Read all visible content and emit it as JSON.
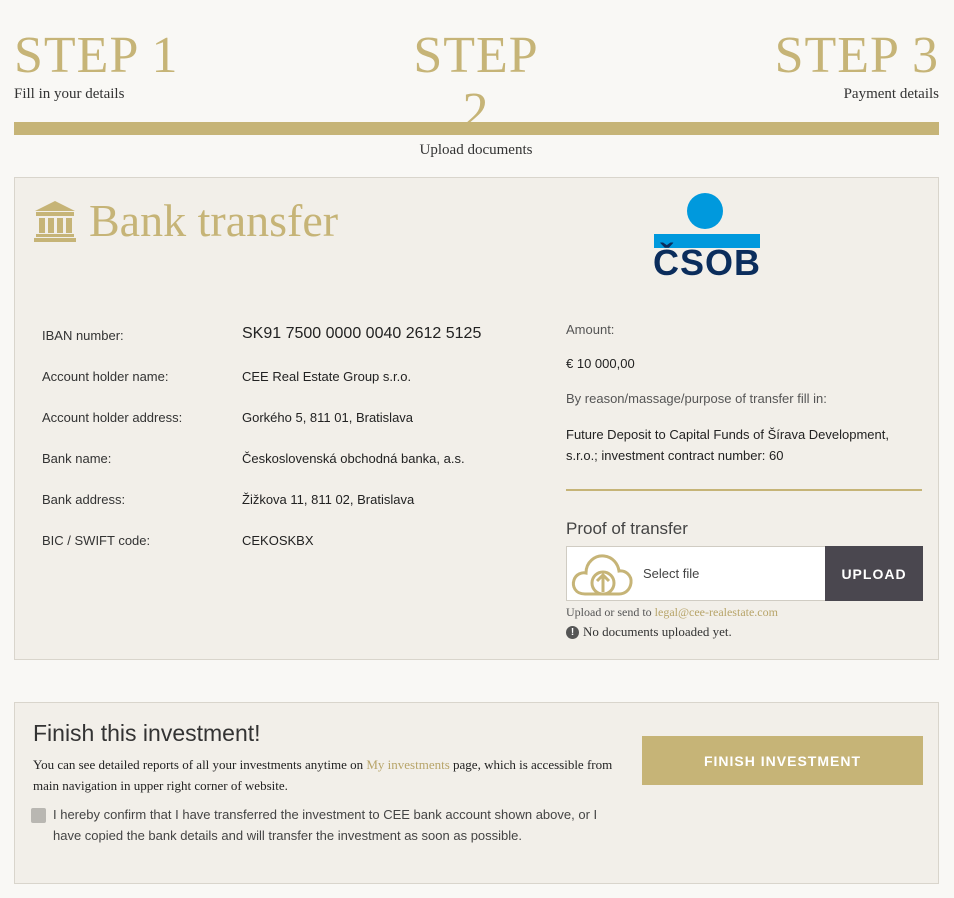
{
  "steps": [
    {
      "num": "STEP 1",
      "desc": "Fill in your details"
    },
    {
      "num": "STEP 2",
      "desc": "Upload documents"
    },
    {
      "num": "STEP 3",
      "desc": "Payment details"
    }
  ],
  "progress_fraction": 1.0,
  "bank_panel": {
    "title": "Bank transfer",
    "title_icon": "bank-icon",
    "logo_text": "ČSOB",
    "details": [
      {
        "label": "IBAN number:",
        "value": "SK91 7500 0000 0040 2612 5125"
      },
      {
        "label": "Account holder name:",
        "value": "CEE Real Estate Group s.r.o."
      },
      {
        "label": "Account holder address:",
        "value": "Gorkého 5, 811 01, Bratislava"
      },
      {
        "label": "Bank name:",
        "value": "Československá obchodná banka, a.s."
      },
      {
        "label": "Bank address:",
        "value": "Žižkova 11, 811 02, Bratislava"
      },
      {
        "label": "BIC / SWIFT code:",
        "value": "CEKOSKBX"
      }
    ],
    "amount_label": "Amount:",
    "amount": "€ 10 000,00",
    "reason_label": "By reason/massage/purpose of transfer fill in:",
    "reason": "Future Deposit to Capital Funds of Šírava Development, s.r.o.; investment contract number: 60",
    "proof_label": "Proof of transfer",
    "select_file": "Select file",
    "upload_button": "UPLOAD",
    "send_note_prefix": "Upload or send to ",
    "send_email": "legal@cee-realestate.com",
    "no_docs": "No documents uploaded yet."
  },
  "finish": {
    "title": "Finish this investment!",
    "info_prefix": "You can see detailed reports of all your investments anytime on ",
    "info_link": "My investments",
    "info_suffix": " page, which is accessible from main navigation in upper right corner of website.",
    "confirm_text": "I hereby confirm that I have transferred the investment to CEE bank account shown above, or I have copied the bank details and will transfer the investment as soon as possible.",
    "button": "FINISH INVESTMENT"
  },
  "colors": {
    "accent": "#c6b477",
    "dark_button": "#4a474f",
    "csob_blue": "#0099dd",
    "csob_navy": "#0b2d5c"
  }
}
